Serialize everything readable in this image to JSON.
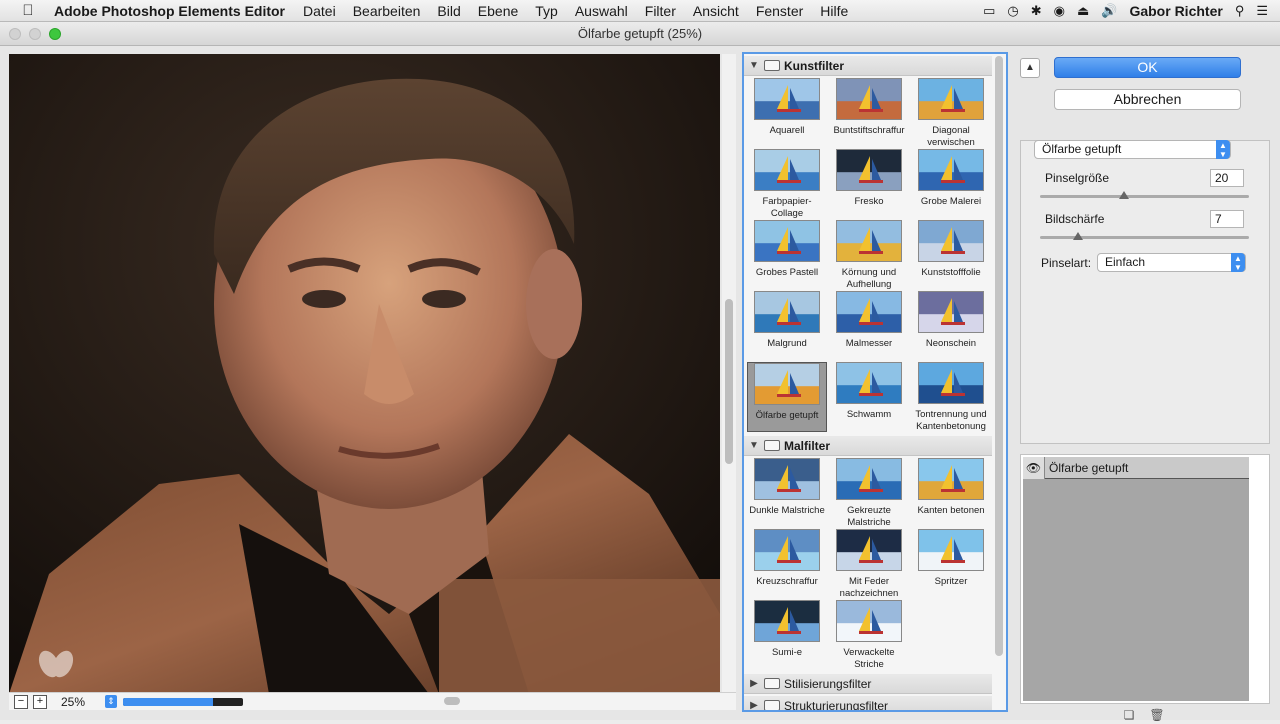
{
  "menubar": {
    "apple_icon": "apple-icon",
    "app_name": "Adobe Photoshop Elements Editor",
    "items": [
      "Datei",
      "Bearbeiten",
      "Bild",
      "Ebene",
      "Typ",
      "Auswahl",
      "Filter",
      "Ansicht",
      "Fenster",
      "Hilfe"
    ],
    "user": "Gabor Richter"
  },
  "window": {
    "title": "Ölfarbe getupft (25%)"
  },
  "preview": {
    "zoom": "25%",
    "zoom_slider_fraction": 0.75
  },
  "gallery": {
    "categories": [
      {
        "name": "Kunstfilter",
        "expanded": true,
        "filters": [
          "Aquarell",
          "Buntstiftschraffur",
          "Diagonal verwischen",
          "Farbpapier-Collage",
          "Fresko",
          "Grobe Malerei",
          "Grobes Pastell",
          "Körnung und Aufhellung",
          "Kunststofffolie",
          "Malgrund",
          "Malmesser",
          "Neonschein",
          "Ölfarbe getupft",
          "Schwamm",
          "Tontrennung und Kantenbetonung"
        ]
      },
      {
        "name": "Malfilter",
        "expanded": true,
        "filters": [
          "Dunkle Malstriche",
          "Gekreuzte Malstriche",
          "Kanten betonen",
          "Kreuzschraffur",
          "Mit Feder nachzeichnen",
          "Spritzer",
          "Sumi-e",
          "Verwackelte Striche"
        ]
      },
      {
        "name": "Stilisierungsfilter",
        "expanded": false
      },
      {
        "name": "Strukturierungsfilter",
        "expanded": false
      }
    ],
    "selected": "Ölfarbe getupft"
  },
  "dialog": {
    "ok_label": "OK",
    "cancel_label": "Abbrechen",
    "filter_select": "Ölfarbe getupft",
    "params": {
      "brush_size_label": "Pinselgröße",
      "brush_size_value": "20",
      "brush_size_fraction": 0.4,
      "sharpness_label": "Bildschärfe",
      "sharpness_value": "7",
      "sharpness_fraction": 0.18,
      "brush_type_label": "Pinselart:",
      "brush_type_value": "Einfach"
    },
    "layer_name": "Ölfarbe getupft"
  },
  "colors": {
    "accent": "#3d8ef0",
    "selection_border": "#5a9ae6"
  }
}
